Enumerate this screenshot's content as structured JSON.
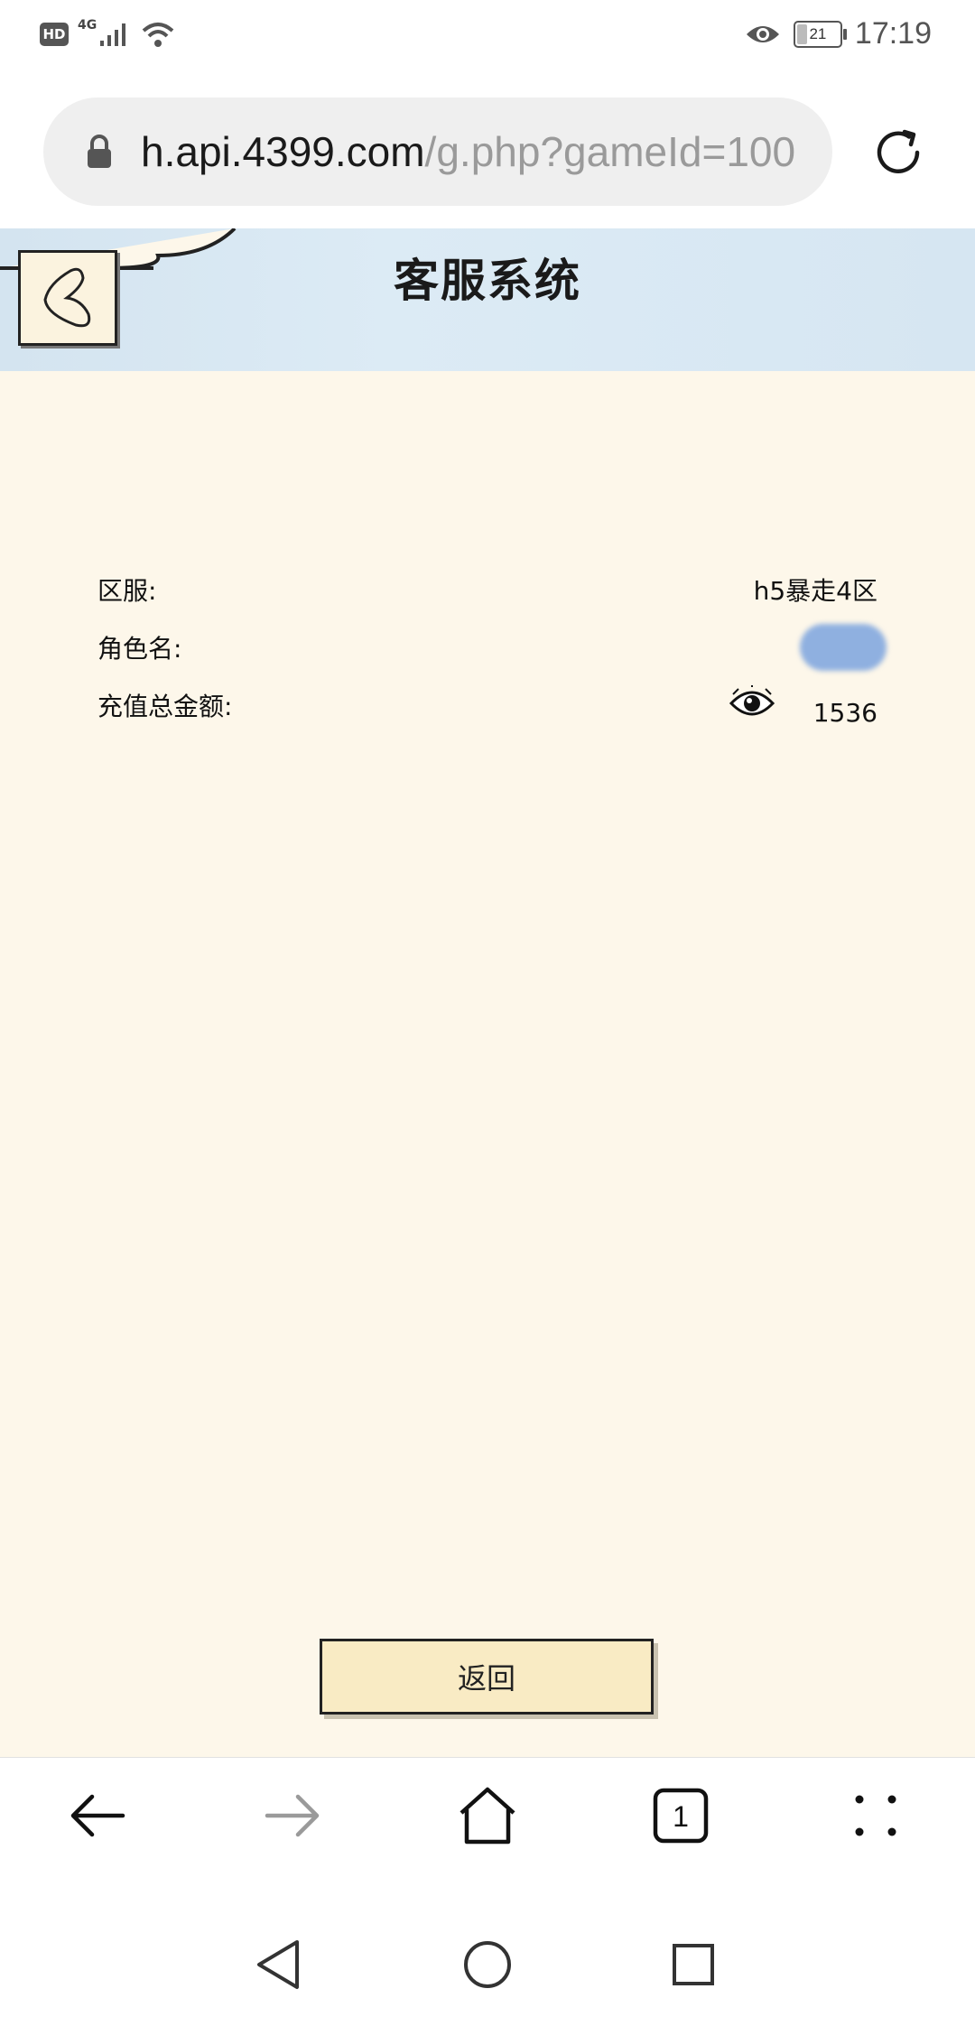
{
  "status_bar": {
    "network": "4G",
    "battery": "21",
    "time": "17:19"
  },
  "browser": {
    "url_host": "h.api.4399.com",
    "url_path": "/g.php?gameId=100",
    "tab_count": "1"
  },
  "page": {
    "title": "客服系统",
    "info": {
      "server_label": "区服:",
      "server_value": "h5暴走4区",
      "role_label": "角色名:",
      "recharge_label": "充值总金额:",
      "recharge_value": "1536"
    },
    "return_button": "返回"
  },
  "icons": [
    "hd-icon",
    "signal-icon",
    "wifi-icon",
    "eye-icon",
    "battery-icon",
    "lock-icon",
    "reload-icon",
    "back-arrow-icon",
    "forward-arrow-icon",
    "home-icon",
    "tabs-icon",
    "menu-icon",
    "system-back-icon",
    "system-home-icon",
    "system-recents-icon"
  ]
}
